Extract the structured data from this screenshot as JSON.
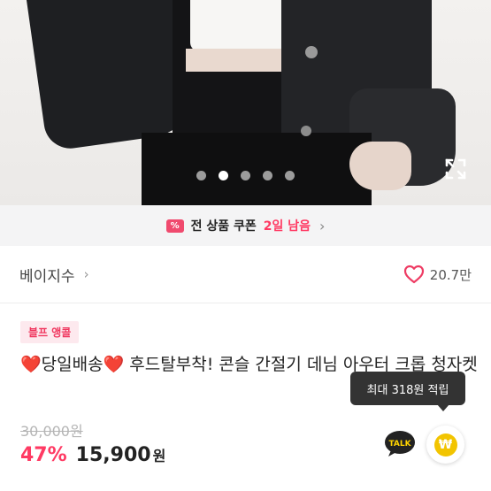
{
  "hero": {
    "total_images": 5,
    "active_index": 1
  },
  "coupon": {
    "icon_text": "%",
    "text": "전 상품 쿠폰",
    "remaining": "2일 남음",
    "chevron": "›"
  },
  "brand": {
    "name": "베이지수",
    "chevron": "›"
  },
  "likes": {
    "count": "20.7만"
  },
  "product": {
    "badge": "블프 앵콜",
    "title_heart": "❤️",
    "title_part1": "당일배송",
    "title_part2": " 후드탈부착! 콘슬 간절기 데님 아우터 크롭 청자켓",
    "original_price": "30,000원",
    "discount": "47%",
    "price": "15,900",
    "currency": "원"
  },
  "tooltip": {
    "text": "최대 318원 적립"
  },
  "actions": {
    "talk_label": "TALK",
    "point_symbol": "₩"
  },
  "colors": {
    "accent": "#ff3a63",
    "coin": "#f2c400"
  }
}
